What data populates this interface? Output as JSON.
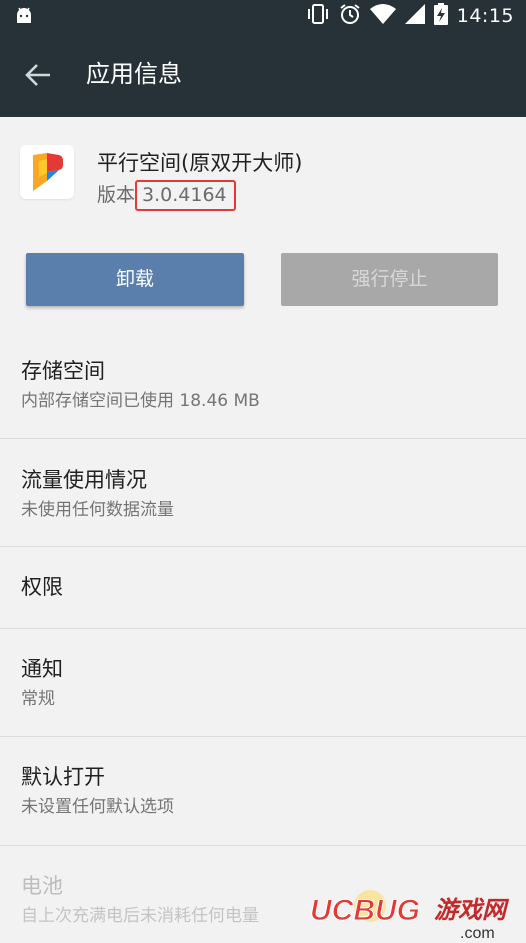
{
  "status_bar": {
    "time": "14:15",
    "icons": [
      "android-icon",
      "vibrate-icon",
      "alarm-icon",
      "wifi-icon",
      "signal-icon",
      "battery-charging-icon"
    ]
  },
  "toolbar": {
    "title": "应用信息",
    "back_icon": "arrow-back-icon"
  },
  "app": {
    "name": "平行空间(原双开大师)",
    "version_label": "版本 ",
    "version": "3.0.4164",
    "icon": "parallel-space-icon"
  },
  "buttons": {
    "uninstall": "卸载",
    "force_stop": "强行停止"
  },
  "settings": [
    {
      "title": "存储空间",
      "subtitle": "内部存储空间已使用 18.46 MB"
    },
    {
      "title": "流量使用情况",
      "subtitle": "未使用任何数据流量"
    },
    {
      "title": "权限"
    },
    {
      "title": "通知",
      "subtitle": "常规"
    },
    {
      "title": "默认打开",
      "subtitle": "未设置任何默认选项"
    },
    {
      "title": "电池",
      "subtitle": "自上次充满电后未消耗任何电量"
    }
  ],
  "watermark": {
    "brand": "UCBUG",
    "text": "游戏网",
    "domain": ".com"
  },
  "colors": {
    "toolbar": "#263238",
    "uninstall_button": "#5b7fac",
    "force_stop_button": "#a8a8a8",
    "version_highlight": "#e53935",
    "background": "#f2f2f2"
  }
}
